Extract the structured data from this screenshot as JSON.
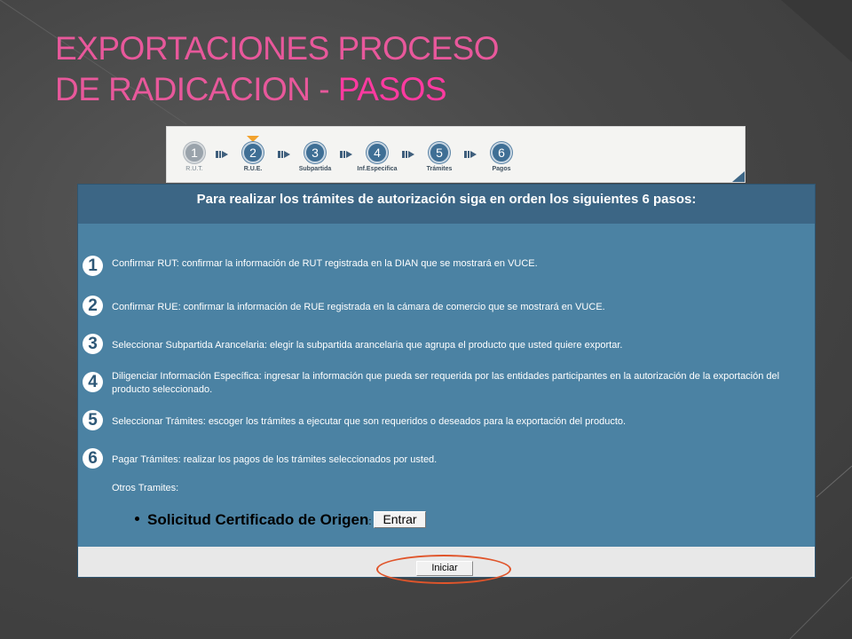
{
  "title": {
    "line1": "EXPORTACIONES PROCESO",
    "line2_prefix": "DE RADICACION - ",
    "line2_accent": "PASOS"
  },
  "wizard": {
    "steps": [
      {
        "number": "1",
        "label": "R.U.T."
      },
      {
        "number": "2",
        "label": "R.U.E."
      },
      {
        "number": "3",
        "label": "Subpartida"
      },
      {
        "number": "4",
        "label": "Inf.Especifica"
      },
      {
        "number": "5",
        "label": "Trámites"
      },
      {
        "number": "6",
        "label": "Pagos"
      }
    ],
    "current_step": 2
  },
  "panel": {
    "header": "Para realizar los trámites de autorización siga en orden los siguientes 6 pasos:",
    "instructions": [
      {
        "number": "1",
        "text": "Confirmar RUT: confirmar la información de RUT registrada en la DIAN que se mostrará en VUCE."
      },
      {
        "number": "2",
        "text": "Confirmar RUE: confirmar la información de RUE registrada en la cámara de comercio que se mostrará en VUCE."
      },
      {
        "number": "3",
        "text": "Seleccionar Subpartida Arancelaria: elegir la subpartida arancelaria que agrupa el producto que usted quiere exportar."
      },
      {
        "number": "4",
        "text": "Diligenciar Información Específica: ingresar la información que pueda ser requerida por las entidades participantes en la autorización de la exportación del producto seleccionado."
      },
      {
        "number": "5",
        "text": "Seleccionar Trámites: escoger los trámites a ejecutar que son requeridos o deseados para la exportación del producto."
      },
      {
        "number": "6",
        "text": "Pagar Trámites: realizar los pagos de los trámites seleccionados por usted."
      }
    ],
    "otros_label": "Otros Tramites:",
    "solicitud_label": "Solicitud Certificado de Origen",
    "solicitud_colon": ":",
    "entrar_label": "Entrar",
    "iniciar_label": "Iniciar"
  },
  "colors": {
    "title": "#e8589b",
    "title_accent": "#ff3aa0",
    "panel": "#4b82a3",
    "panel_header": "#3c6685",
    "highlight": "#e0552b",
    "active_marker": "#f2a22d"
  }
}
